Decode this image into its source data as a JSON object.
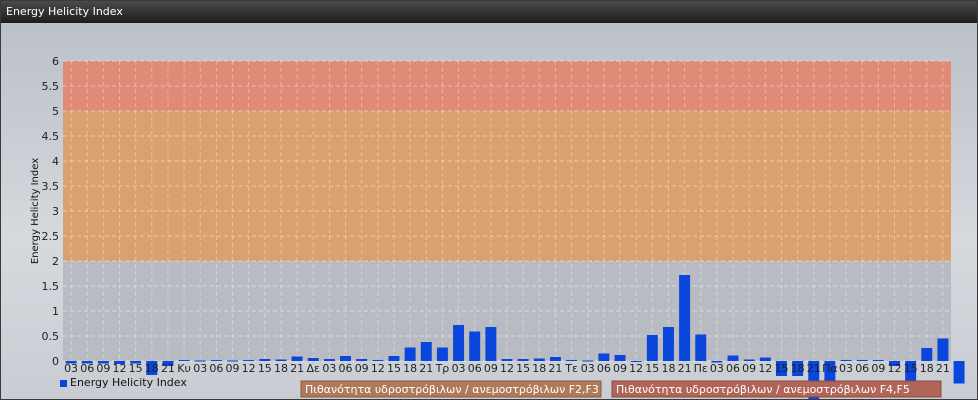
{
  "window": {
    "title": "Energy Helicity Index"
  },
  "chart_data": {
    "type": "bar",
    "title": "",
    "xlabel": "",
    "ylabel": "Energy Helicity Index",
    "ylim": [
      0,
      6
    ],
    "yticks": [
      "0",
      "0.5",
      "1",
      "1.5",
      "2",
      "2.5",
      "3",
      "3.5",
      "4",
      "4.5",
      "5",
      "5.5",
      "6"
    ],
    "grid": true,
    "bands": [
      {
        "from": 0,
        "to": 2,
        "color": "#b8bcc2"
      },
      {
        "from": 2,
        "to": 5,
        "color": "#d9a070"
      },
      {
        "from": 5,
        "to": 6,
        "color": "#e08a78"
      }
    ],
    "categories": [
      "03",
      "06",
      "09",
      "12",
      "15",
      "18",
      "21",
      "Κυ",
      "03",
      "06",
      "09",
      "12",
      "15",
      "18",
      "21",
      "Δε",
      "03",
      "06",
      "09",
      "12",
      "15",
      "18",
      "21",
      "Τρ",
      "03",
      "06",
      "09",
      "12",
      "15",
      "18",
      "21",
      "Τε",
      "03",
      "06",
      "09",
      "12",
      "15",
      "18",
      "21",
      "Πε",
      "03",
      "06",
      "09",
      "12",
      "15",
      "18",
      "21",
      "Πα",
      "03",
      "06",
      "09",
      "12",
      "15",
      "18",
      "21"
    ],
    "series": [
      {
        "name": "Energy Helicity Index",
        "color": "#0a46dc",
        "values": [
          -0.05,
          -0.05,
          -0.05,
          -0.06,
          -0.05,
          -0.28,
          -0.1,
          0.02,
          0.01,
          0.02,
          0.01,
          0.02,
          0.04,
          0.03,
          0.09,
          0.06,
          0.04,
          0.1,
          0.04,
          0.02,
          0.1,
          0.27,
          0.38,
          0.27,
          0.72,
          0.59,
          0.68,
          0.04,
          0.04,
          0.05,
          0.08,
          0.02,
          0.01,
          0.15,
          0.12,
          -0.02,
          0.52,
          0.68,
          1.72,
          0.53,
          -0.03,
          0.11,
          0.03,
          0.07,
          -0.3,
          -0.3,
          -0.8,
          -0.45,
          0.02,
          0.02,
          0.02,
          -0.1,
          -0.42,
          0.26,
          0.45,
          -0.45
        ]
      }
    ],
    "annotations": [
      {
        "text": "Πιθανότητα υδροστρόβιλων / ανεμοστρόβιλων F2,F3",
        "color": "#b07a5a"
      },
      {
        "text": "Πιθανότητα υδροστρόβιλων / ανεμοστρόβιλων F4,F5",
        "color": "#b06558"
      }
    ]
  }
}
